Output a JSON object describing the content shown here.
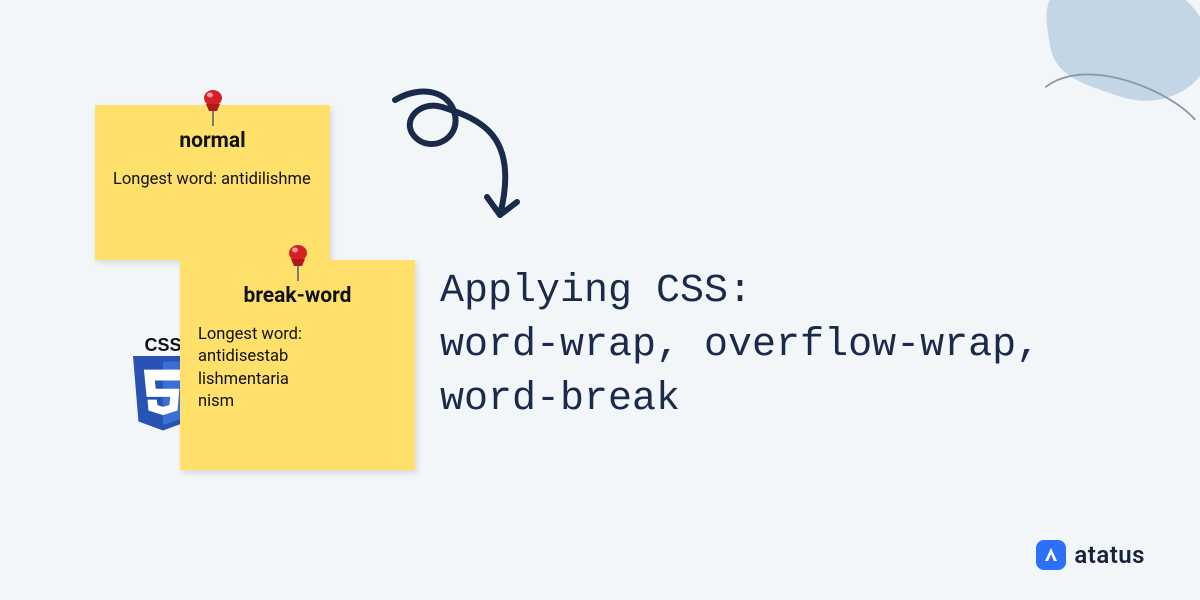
{
  "notes": {
    "note1": {
      "heading": "normal",
      "label": "Longest word: ",
      "value": "antidilishme"
    },
    "note2": {
      "heading": "break-word",
      "label": "Longest word: ",
      "value": "antidisestab lishmentaria nism"
    }
  },
  "css_badge_text": "CSS",
  "title_line1": "Applying CSS:",
  "title_line2": "word-wrap, overflow-wrap, word-break",
  "brand": {
    "name": "atatus"
  },
  "icons": {
    "pushpin": "pushpin-icon",
    "css3_shield": "css3-shield-icon",
    "loop_arrow": "loop-arrow-icon",
    "blob": "decorative-blob"
  },
  "colors": {
    "bg": "#f3f6f9",
    "sticky": "#ffe06a",
    "ink": "#1a2a4a",
    "brand_blue": "#2d6ff6",
    "css_shield": "#2953b2",
    "pin_red": "#d62027"
  }
}
